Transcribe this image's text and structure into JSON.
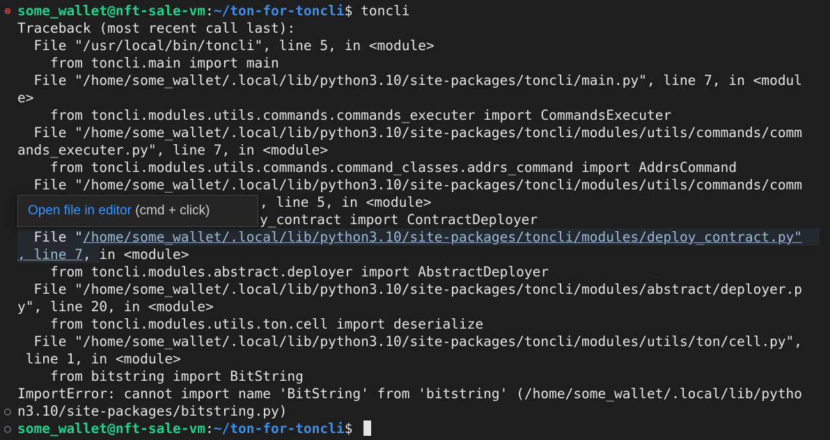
{
  "prompt": {
    "user_host": "some_wallet@nft-sale-vm",
    "separator": ":",
    "path": "~/ton-for-toncli",
    "symbol": "$ "
  },
  "command": "toncli",
  "output": {
    "l01": "Traceback (most recent call last):",
    "l02": "  File \"/usr/local/bin/toncli\", line 5, in <module>",
    "l03": "    from toncli.main import main",
    "l04": "  File \"/home/some_wallet/.local/lib/python3.10/site-packages/toncli/main.py\", line 7, in <modul",
    "l05": "e>",
    "l06": "    from toncli.modules.utils.commands.commands_executer import CommandsExecuter",
    "l07": "  File \"/home/some_wallet/.local/lib/python3.10/site-packages/toncli/modules/utils/commands/comm",
    "l08": "ands_executer.py\", line 7, in <module>",
    "l09": "    from toncli.modules.utils.commands.command_classes.addrs_command import AddrsCommand",
    "l10": "  File \"/home/some_wallet/.local/lib/python3.10/site-packages/toncli/modules/utils/commands/comm",
    "l11_tail": ", line 5, in <module>",
    "l12_tail": "y_contract import ContractDeployer",
    "l13_pre": "  File \"",
    "l13_link": "/home/some_wallet/.local/lib/python3.10/site-packages/toncli/modules/deploy_contract.py\"",
    "l14_link": ", line 7",
    "l14_tail": ", in <module>",
    "l15": "    from toncli.modules.abstract.deployer import AbstractDeployer",
    "l16": "  File \"/home/some_wallet/.local/lib/python3.10/site-packages/toncli/modules/abstract/deployer.p",
    "l17": "y\", line 20, in <module>",
    "l18": "    from toncli.modules.utils.ton.cell import deserialize",
    "l19": "  File \"/home/some_wallet/.local/lib/python3.10/site-packages/toncli/modules/utils/ton/cell.py\",",
    "l20": " line 1, in <module>",
    "l21": "    from bitstring import BitString",
    "l22": "ImportError: cannot import name 'BitString' from 'bitstring' (/home/some_wallet/.local/lib/pytho",
    "l23": "n3.10/site-packages/bitstring.py)"
  },
  "tooltip": {
    "action": "Open file in editor",
    "hint": " (cmd + click)"
  },
  "colors": {
    "background": "#1e1e1e",
    "text": "#e4e4e4",
    "prompt_user": "#23d18b",
    "prompt_path": "#3b8eea",
    "error_mark": "#f14c4c",
    "link": "#3794ff"
  },
  "icons": {
    "error_mark": "error-circle-icon",
    "idle_mark": "command-idle-circle-icon"
  }
}
